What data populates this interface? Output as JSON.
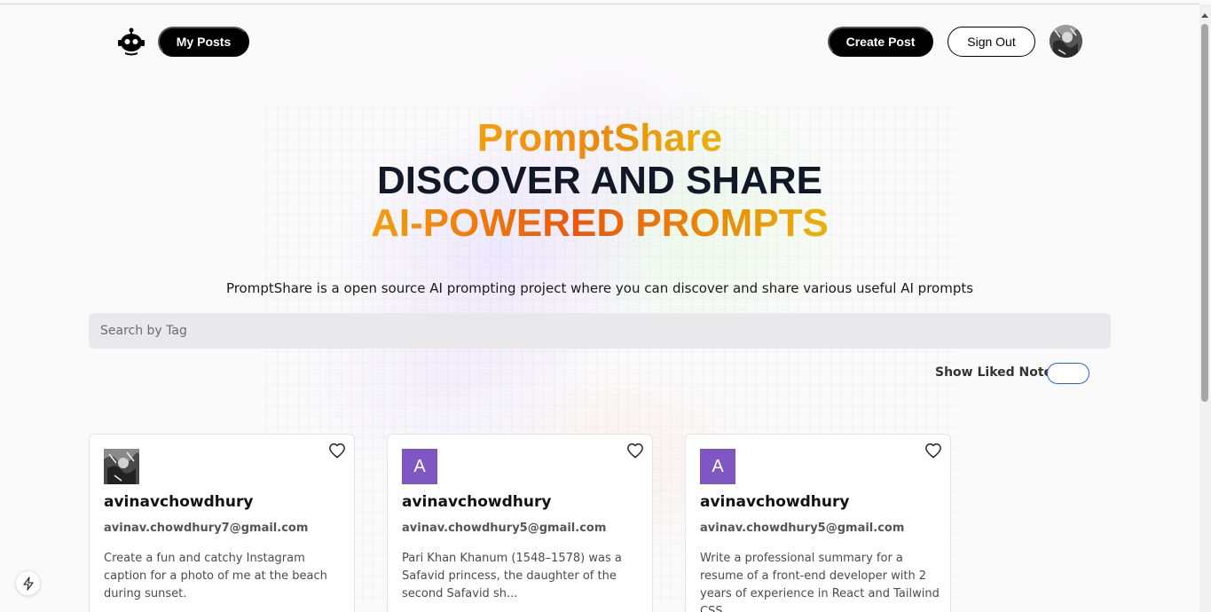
{
  "header": {
    "logo_icon": "robot-icon",
    "my_posts_label": "My Posts",
    "create_post_label": "Create Post",
    "sign_out_label": "Sign Out",
    "avatar_icon": "user-avatar"
  },
  "hero": {
    "brand": "PromptShare",
    "line2": "DISCOVER AND SHARE",
    "line3": "AI-POWERED PROMPTS",
    "subtitle": "PromptShare is a open source AI prompting project where you can discover and share various useful AI prompts"
  },
  "search": {
    "placeholder": "Search by Tag",
    "value": ""
  },
  "filter": {
    "liked_label": "Show Liked Notes",
    "liked_on": false
  },
  "cards": [
    {
      "avatar": "photo",
      "username": "avinavchowdhury",
      "email": "avinav.chowdhury7@gmail.com",
      "prompt": "Create a fun and catchy Instagram caption for a photo of me at the beach during sunset."
    },
    {
      "avatar": "A",
      "username": "avinavchowdhury",
      "email": "avinav.chowdhury5@gmail.com",
      "prompt": "Pari Khan Khanum (1548–1578) was a Safavid princess, the daughter of the second Safavid sh..."
    },
    {
      "avatar": "A",
      "username": "avinavchowdhury",
      "email": "avinav.chowdhury5@gmail.com",
      "prompt": "Write a professional summary for a resume of a front-end developer with 2 years of experience in React and Tailwind CSS"
    }
  ],
  "colors": {
    "accent_orange": "#ea580c",
    "accent_amber": "#f59e0b",
    "toggle_border": "#2563eb",
    "avatar_purple": "#7e57c2"
  },
  "floating": {
    "icon": "lightning-icon"
  }
}
